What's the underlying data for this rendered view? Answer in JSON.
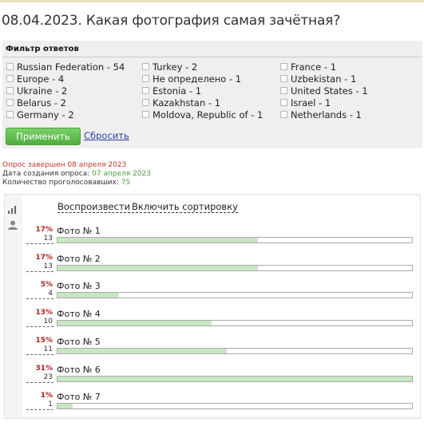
{
  "title": "08.04.2023. Какая фотография самая зачётная?",
  "filter": {
    "title": "Фильтр ответов",
    "columns": [
      [
        "Russian Federation - 54",
        "Europe - 4",
        "Ukraine - 2",
        "Belarus - 2",
        "Germany - 2"
      ],
      [
        "Turkey - 2",
        "Не определено - 1",
        "Estonia - 1",
        "Kazakhstan - 1",
        "Moldova, Republic of - 1"
      ],
      [
        "France - 1",
        "Uzbekistan - 1",
        "United States - 1",
        "Israel - 1",
        "Netherlands - 1"
      ]
    ],
    "apply_label": "Применить",
    "reset_label": "Сбросить"
  },
  "info": {
    "finished_label": "Опрос завершен",
    "finished_date": "08 апреля 2023",
    "created_label": "Дата создания опроса:",
    "created_date": "07 апреля 2023",
    "voters_label": "Количество проголосовавших:",
    "voters_count": "75"
  },
  "results": {
    "icons": [
      "bar-chart-icon",
      "user-icon"
    ],
    "play_label": "Воспроизвести",
    "sort_label": "Включить сортировку",
    "max_count": 23,
    "rows": [
      {
        "label": "Фото № 1",
        "percent": "17%",
        "count": 13
      },
      {
        "label": "Фото № 2",
        "percent": "17%",
        "count": 13
      },
      {
        "label": "Фото № 3",
        "percent": "5%",
        "count": 4
      },
      {
        "label": "Фото № 4",
        "percent": "13%",
        "count": 10
      },
      {
        "label": "Фото № 5",
        "percent": "15%",
        "count": 11
      },
      {
        "label": "Фото № 6",
        "percent": "31%",
        "count": 23
      },
      {
        "label": "Фото № 7",
        "percent": "1%",
        "count": 1
      }
    ]
  },
  "colors": {
    "bar_fill": "#c9e6c3",
    "percent_text": "#b22222",
    "finished_text": "#c0392b",
    "created_date_text": "#4a9e3a",
    "apply_button": "#5cb84a"
  }
}
